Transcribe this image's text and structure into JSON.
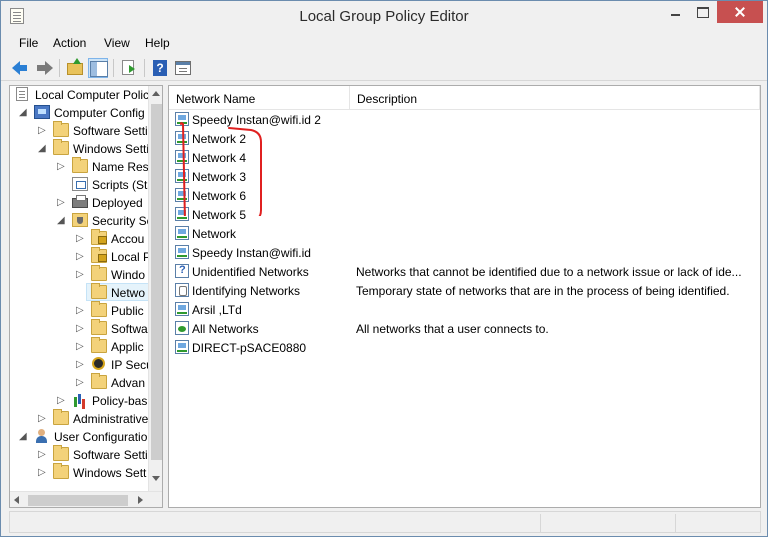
{
  "window": {
    "title": "Local Group Policy Editor"
  },
  "menu": {
    "items": [
      "File",
      "Action",
      "View",
      "Help"
    ]
  },
  "toolbar": {
    "icons": [
      "back-arrow-icon",
      "forward-arrow-icon",
      "up-folder-icon",
      "show-hide-tree-icon",
      "export-list-icon",
      "help-icon",
      "properties-icon"
    ]
  },
  "tree": {
    "items": [
      {
        "label": "Local Computer Polic",
        "icon": "policy-doc-icon",
        "expander": ""
      },
      {
        "label": "Computer Config",
        "icon": "computer-icon",
        "expander": "◢"
      },
      {
        "label": "Software Setti",
        "icon": "folder-icon",
        "expander": "▷"
      },
      {
        "label": "Windows Setti",
        "icon": "folder-icon",
        "expander": "◢"
      },
      {
        "label": "Name Res",
        "icon": "folder-icon",
        "expander": "▷"
      },
      {
        "label": "Scripts (Sta",
        "icon": "script-icon",
        "expander": ""
      },
      {
        "label": "Deployed",
        "icon": "printer-icon",
        "expander": "▷"
      },
      {
        "label": "Security Se",
        "icon": "security-folder-icon",
        "expander": "◢"
      },
      {
        "label": "Accou",
        "icon": "locked-folder-icon",
        "expander": "▷"
      },
      {
        "label": "Local P",
        "icon": "locked-folder-icon",
        "expander": "▷"
      },
      {
        "label": "Windo",
        "icon": "folder-icon",
        "expander": "▷"
      },
      {
        "label": "Netwo",
        "icon": "folder-icon",
        "expander": ""
      },
      {
        "label": "Public",
        "icon": "folder-icon",
        "expander": "▷"
      },
      {
        "label": "Softwa",
        "icon": "folder-icon",
        "expander": "▷"
      },
      {
        "label": "Applic",
        "icon": "folder-icon",
        "expander": "▷"
      },
      {
        "label": "IP Secu",
        "icon": "ipsec-icon",
        "expander": "▷"
      },
      {
        "label": "Advan",
        "icon": "folder-icon",
        "expander": "▷"
      },
      {
        "label": "Policy-bas",
        "icon": "chart-icon",
        "expander": "▷"
      },
      {
        "label": "Administrative",
        "icon": "folder-icon",
        "expander": "▷"
      },
      {
        "label": "User Configuratio",
        "icon": "user-icon",
        "expander": "◢"
      },
      {
        "label": "Software Setti",
        "icon": "folder-icon",
        "expander": "▷"
      },
      {
        "label": "Windows Sett",
        "icon": "folder-icon",
        "expander": "▷"
      }
    ]
  },
  "list": {
    "columns": [
      "Network Name",
      "Description"
    ],
    "rows": [
      {
        "name": "Speedy Instan@wifi.id  2",
        "description": "",
        "icon": "network-icon"
      },
      {
        "name": "Network  2",
        "description": "",
        "icon": "network-icon"
      },
      {
        "name": "Network  4",
        "description": "",
        "icon": "network-icon"
      },
      {
        "name": "Network  3",
        "description": "",
        "icon": "network-icon"
      },
      {
        "name": "Network  6",
        "description": "",
        "icon": "network-icon"
      },
      {
        "name": "Network  5",
        "description": "",
        "icon": "network-icon"
      },
      {
        "name": "Network",
        "description": "",
        "icon": "network-icon"
      },
      {
        "name": "Speedy Instan@wifi.id",
        "description": "",
        "icon": "network-icon"
      },
      {
        "name": "Unidentified Networks",
        "description": "Networks that cannot be identified due to a network issue or lack of ide...",
        "icon": "unidentified-network-icon"
      },
      {
        "name": "Identifying Networks",
        "description": "Temporary state of networks that are in the process of being identified.",
        "icon": "identifying-network-icon"
      },
      {
        "name": "Arsil ,LTd",
        "description": "",
        "icon": "network-icon"
      },
      {
        "name": "All Networks",
        "description": "All networks that a user connects to.",
        "icon": "all-networks-icon"
      },
      {
        "name": "DIRECT-pSACE0880",
        "description": "",
        "icon": "network-icon"
      }
    ]
  },
  "annotation": {
    "color": "#e02020"
  }
}
